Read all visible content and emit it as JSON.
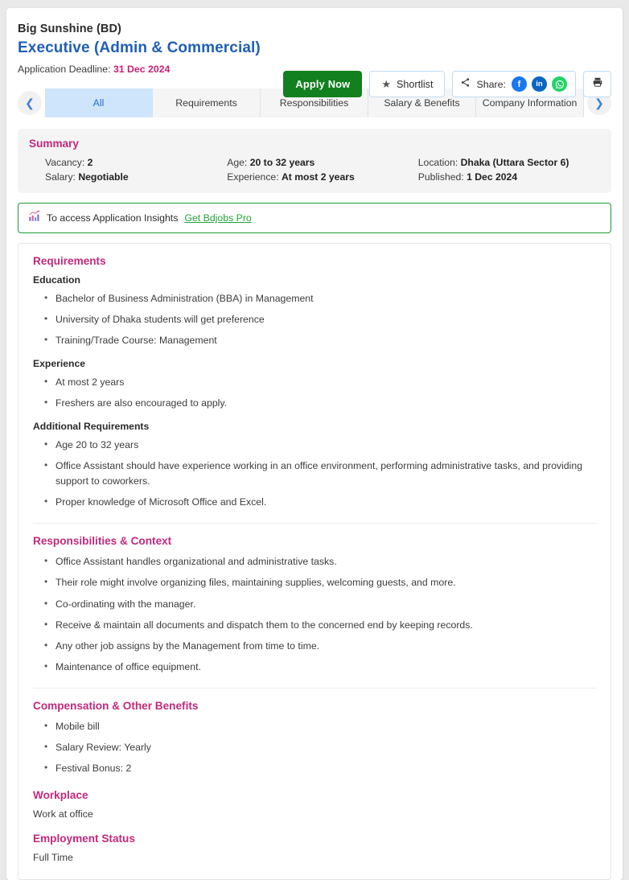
{
  "header": {
    "company": "Big Sunshine (BD)",
    "job_title": "Executive (Admin & Commercial)",
    "deadline_label": "Application Deadline:",
    "deadline_value": "31 Dec 2024"
  },
  "actions": {
    "apply_label": "Apply Now",
    "shortlist_label": "Shortlist",
    "share_label": "Share:",
    "share_targets": [
      {
        "name": "facebook",
        "glyph": "f",
        "color": "#1877f2"
      },
      {
        "name": "linkedin",
        "glyph": "in",
        "color": "#0a66c2"
      },
      {
        "name": "whatsapp",
        "glyph": "✆",
        "color": "#25d366"
      }
    ],
    "print_icon": "print-icon",
    "star_icon": "star-icon",
    "share_icon": "share-icon"
  },
  "tabs": {
    "prev_icon": "chevron-left-icon",
    "next_icon": "chevron-right-icon",
    "items": [
      {
        "label": "All",
        "active": true
      },
      {
        "label": "Requirements",
        "active": false
      },
      {
        "label": "Responsibilities",
        "active": false
      },
      {
        "label": "Salary & Benefits",
        "active": false
      },
      {
        "label": "Company Information",
        "active": false
      }
    ]
  },
  "summary": {
    "title": "Summary",
    "fields": [
      {
        "label": "Vacancy:",
        "value": "2"
      },
      {
        "label": "Age:",
        "value": "20 to 32 years"
      },
      {
        "label": "Location:",
        "value": "Dhaka (Uttara Sector 6)"
      },
      {
        "label": "Salary:",
        "value": "Negotiable"
      },
      {
        "label": "Experience:",
        "value": "At most 2 years"
      },
      {
        "label": "Published:",
        "value": "1 Dec 2024"
      }
    ]
  },
  "pro_banner": {
    "icon": "insights-chart-icon",
    "text": "To access Application Insights",
    "link": "Get Bdjobs Pro"
  },
  "sections": {
    "requirements": {
      "title": "Requirements",
      "education_label": "Education",
      "education": [
        "Bachelor of Business Administration (BBA) in Management",
        "University of Dhaka students will get preference",
        "Training/Trade Course: Management"
      ],
      "experience_label": "Experience",
      "experience": [
        "At most 2 years",
        "Freshers are also encouraged to apply."
      ],
      "additional_label": "Additional Requirements",
      "additional": [
        "Age 20 to 32 years",
        "Office Assistant should have experience working in an office environment, performing administrative tasks, and providing support to coworkers.",
        "Proper knowledge of Microsoft Office and Excel."
      ]
    },
    "responsibilities": {
      "title": "Responsibilities & Context",
      "items": [
        "Office Assistant handles organizational and administrative tasks.",
        "Their role might involve organizing files, maintaining supplies, welcoming guests, and more.",
        "Co-ordinating with the manager.",
        "Receive & maintain all documents and dispatch them to the concerned end by keeping records.",
        "Any other job assigns by the Management from time to time.",
        "Maintenance of office equipment."
      ]
    },
    "compensation": {
      "title": "Compensation & Other Benefits",
      "items": [
        "Mobile bill",
        "Salary Review: Yearly",
        "Festival Bonus: 2"
      ]
    },
    "workplace": {
      "title": "Workplace",
      "text": "Work at office"
    },
    "employment_status": {
      "title": "Employment Status",
      "text": "Full Time"
    }
  },
  "colors": {
    "accent_pink": "#c2297c",
    "link_blue": "#1f5fb5",
    "apply_green": "#13801f",
    "pro_green": "#23a43a",
    "tab_active_bg": "#cfe5fb"
  }
}
